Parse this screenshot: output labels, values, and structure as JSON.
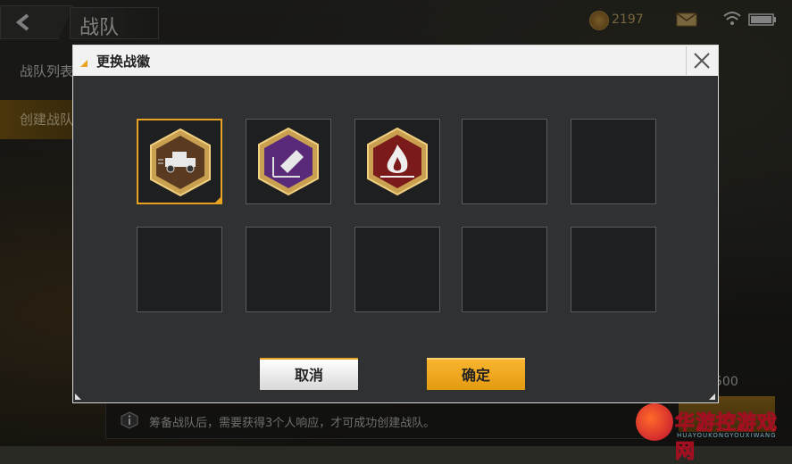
{
  "header": {
    "title": "战队",
    "back_icon": "back-arrow-icon",
    "coins": "2197",
    "coin_icon": "coin-icon",
    "mail_icon": "mail-icon",
    "wifi_icon": "wifi-icon",
    "battery_icon": "battery-icon"
  },
  "sidebar": {
    "items": [
      {
        "label": "战队列表"
      },
      {
        "label": "创建战队"
      }
    ]
  },
  "footer": {
    "info_icon": "info-icon",
    "text": "筹备战队后，需要获得3个人响应，才可成功创建战队。",
    "count": "500"
  },
  "watermark": {
    "text": "华游控游戏网",
    "sub": "HUAYOUKONGYOUXIWANG"
  },
  "dialog": {
    "title": "更换战徽",
    "close_icon": "close-icon",
    "accent_color": "#e8a320",
    "slots": [
      {
        "icon": "jeep-badge-icon",
        "selected": true
      },
      {
        "icon": "bullet-badge-icon",
        "selected": false
      },
      {
        "icon": "fire-badge-icon",
        "selected": false
      },
      {
        "icon": "",
        "selected": false
      },
      {
        "icon": "",
        "selected": false
      },
      {
        "icon": "",
        "selected": false
      },
      {
        "icon": "",
        "selected": false
      },
      {
        "icon": "",
        "selected": false
      },
      {
        "icon": "",
        "selected": false
      },
      {
        "icon": "",
        "selected": false
      }
    ],
    "cancel_label": "取消",
    "confirm_label": "确定"
  }
}
